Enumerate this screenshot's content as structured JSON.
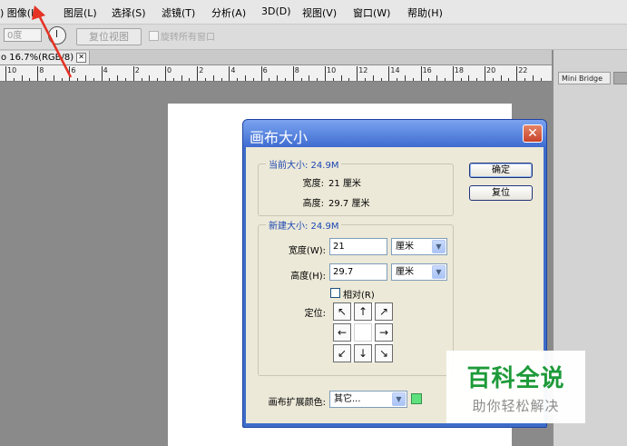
{
  "menu": [
    {
      "id": "image",
      "label": ") 图像(I)"
    },
    {
      "id": "layer",
      "label": "图层(L)"
    },
    {
      "id": "select",
      "label": "选择(S)"
    },
    {
      "id": "filter",
      "label": "滤镜(T)"
    },
    {
      "id": "analysis",
      "label": "分析(A)"
    },
    {
      "id": "3d",
      "label": "3D(D)"
    },
    {
      "id": "view",
      "label": "视图(V)"
    },
    {
      "id": "window",
      "label": "窗口(W)"
    },
    {
      "id": "help",
      "label": "帮助(H)"
    }
  ],
  "options_bar": {
    "angle_value": "0度",
    "reset_view_label": "复位视图",
    "rotate_all_label": "旋转所有窗口"
  },
  "document_tab": {
    "label": "o 16.7%(RGB/8)",
    "close_glyph": "✕"
  },
  "ruler_numbers": [
    "10",
    "8",
    "6",
    "4",
    "2",
    "0",
    "2",
    "4",
    "6",
    "8",
    "10",
    "12",
    "14",
    "16",
    "18",
    "20",
    "22"
  ],
  "panel": {
    "mini_bridge_label": "Mini Bridge"
  },
  "dialog": {
    "title": "画布大小",
    "close_glyph": "✕",
    "current_size": {
      "title": "当前大小: 24.9M",
      "width_label": "宽度:",
      "width_value": "21 厘米",
      "height_label": "高度:",
      "height_value": "29.7 厘米"
    },
    "ok_label": "确定",
    "reset_label": "复位",
    "new_size": {
      "title": "新建大小: 24.9M",
      "width_label": "宽度(W):",
      "width_value": "21",
      "width_unit": "厘米",
      "height_label": "高度(H):",
      "height_value": "29.7",
      "height_unit": "厘米",
      "relative_label": "相对(R)",
      "relative_checked": false,
      "anchor_label": "定位:"
    },
    "anchor_arrows": [
      "↖",
      "↑",
      "↗",
      "←",
      "",
      "→",
      "↙",
      "↓",
      "↘"
    ],
    "extension_color_label": "画布扩展颜色:",
    "extension_color_value": "其它...",
    "extension_color_swatch": "#5de27e",
    "dropdown_glyph": "▼"
  },
  "watermark": {
    "title": "百科全说",
    "subtitle": "助你轻松解决"
  },
  "colors": {
    "dialog_frame": "#3e6cc9",
    "group_title": "#1c46b3",
    "watermark_green": "#1d9a39",
    "annotation_arrow": "#e53224"
  }
}
